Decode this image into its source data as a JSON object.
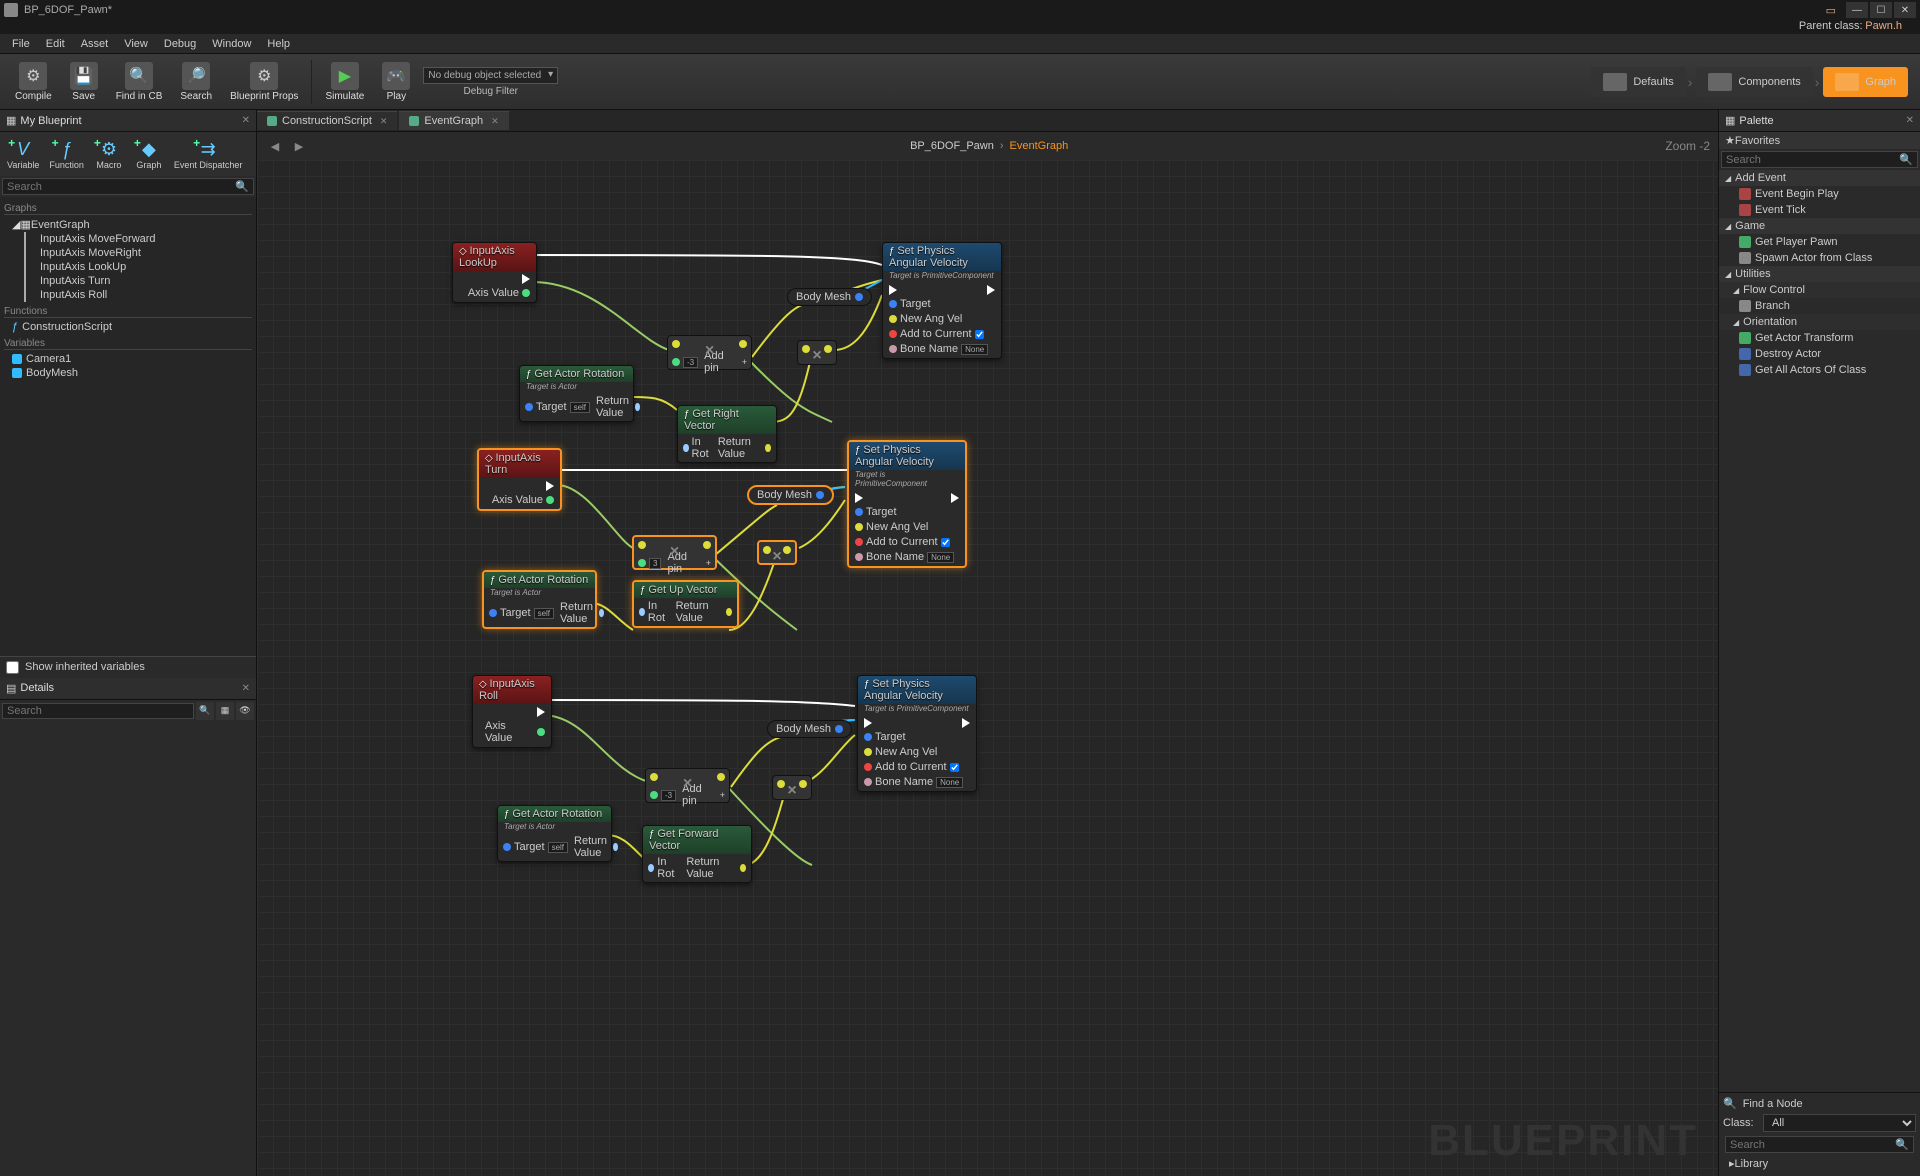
{
  "title": "BP_6DOF_Pawn*",
  "parentClassLabel": "Parent class:",
  "parentClass": "Pawn.h",
  "menu": [
    "File",
    "Edit",
    "Asset",
    "View",
    "Debug",
    "Window",
    "Help"
  ],
  "toolbar": [
    {
      "id": "compile",
      "label": "Compile",
      "icon": "⚙"
    },
    {
      "id": "save",
      "label": "Save",
      "icon": "💾"
    },
    {
      "id": "findcb",
      "label": "Find in CB",
      "icon": "🔍"
    },
    {
      "id": "search",
      "label": "Search",
      "icon": "🔎"
    },
    {
      "id": "bpprops",
      "label": "Blueprint Props",
      "icon": "⚙"
    },
    {
      "id": "simulate",
      "label": "Simulate",
      "icon": "▶"
    },
    {
      "id": "play",
      "label": "Play",
      "icon": "🎮"
    }
  ],
  "debugFilter": {
    "value": "No debug object selected",
    "label": "Debug Filter"
  },
  "modeTabs": [
    {
      "label": "Defaults",
      "active": false
    },
    {
      "label": "Components",
      "active": false
    },
    {
      "label": "Graph",
      "active": true
    }
  ],
  "myBlueprint": {
    "title": "My Blueprint",
    "buttons": [
      {
        "label": "Variable",
        "sym": "V"
      },
      {
        "label": "Function",
        "sym": "ƒ"
      },
      {
        "label": "Macro",
        "sym": "⚙"
      },
      {
        "label": "Graph",
        "sym": "◆"
      },
      {
        "label": "Event Dispatcher",
        "sym": "⇉"
      }
    ],
    "searchPlaceholder": "Search",
    "sections": {
      "graphs": "Graphs",
      "functions": "Functions",
      "variables": "Variables"
    },
    "eventGraph": "EventGraph",
    "graphItems": [
      "InputAxis MoveForward",
      "InputAxis MoveRight",
      "InputAxis LookUp",
      "InputAxis Turn",
      "InputAxis Roll"
    ],
    "constructionScript": "ConstructionScript",
    "vars": [
      "Camera1",
      "BodyMesh"
    ],
    "showInherited": "Show inherited variables"
  },
  "details": {
    "title": "Details",
    "searchPlaceholder": "Search"
  },
  "graphTabs": [
    {
      "label": "ConstructionScript",
      "active": false
    },
    {
      "label": "EventGraph",
      "active": true
    }
  ],
  "breadcrumb": {
    "bp": "BP_6DOF_Pawn",
    "graph": "EventGraph"
  },
  "zoom": "Zoom -2",
  "watermark": "BLUEPRINT",
  "palette": {
    "title": "Palette",
    "favorites": "Favorites",
    "searchPlaceholder": "Search",
    "groups": [
      {
        "name": "Add Event",
        "items": [
          "Event Begin Play",
          "Event Tick"
        ]
      },
      {
        "name": "Game",
        "items": [
          "Get Player Pawn",
          "Spawn Actor from Class"
        ]
      },
      {
        "name": "Utilities",
        "items": []
      },
      {
        "name": "Flow Control",
        "items": [
          "Branch"
        ]
      },
      {
        "name": "Orientation",
        "items": [
          "Get Actor Transform",
          "Destroy Actor",
          "Get All Actors Of Class"
        ]
      }
    ],
    "findNode": "Find a Node",
    "classLabel": "Class:",
    "classValue": "All",
    "library": "Library"
  },
  "nodes": {
    "inputLookUp": "InputAxis LookUp",
    "inputTurn": "InputAxis Turn",
    "inputRoll": "InputAxis Roll",
    "axisValue": "Axis Value",
    "setPhysAngVel": "Set Physics Angular Velocity",
    "setPhysSub": "Target is PrimitiveComponent",
    "target": "Target",
    "newAngVel": "New Ang Vel",
    "addToCurrent": "Add to Current",
    "boneName": "Bone Name",
    "none": "None",
    "getActorRot": "Get Actor Rotation",
    "getActorSub": "Target is Actor",
    "self": "self",
    "returnValue": "Return Value",
    "getRightVec": "Get Right Vector",
    "getUpVec": "Get Up Vector",
    "getFwdVec": "Get Forward Vector",
    "inRot": "In Rot",
    "bodyMesh": "Body Mesh",
    "addPin": "Add pin",
    "multVal1": "-3",
    "multVal2": "3",
    "multVal3": "-3"
  }
}
